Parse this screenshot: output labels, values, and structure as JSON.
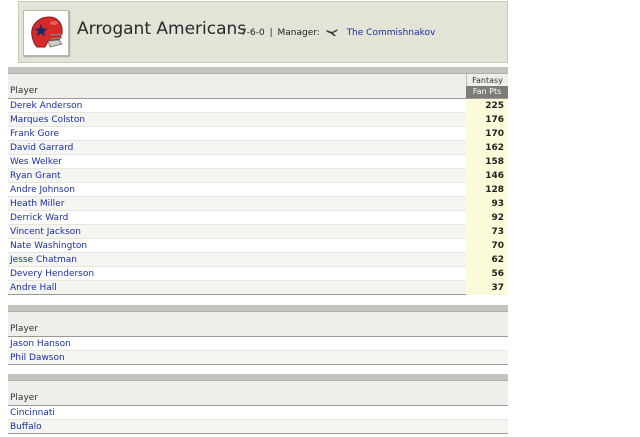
{
  "team": {
    "name": "Arrogant Americans",
    "record": "7-6-0",
    "separator": "|",
    "manager_label": "Manager:",
    "manager_name": "The Commishnakov",
    "logo_icon": "football-helmet-icon",
    "manager_icon": "airplane-icon"
  },
  "starters": {
    "header_player": "Player",
    "header_group": "Fantasy",
    "header_points": "Fan Pts",
    "rows": [
      {
        "name": "Derek Anderson",
        "pts": "225"
      },
      {
        "name": "Marques Colston",
        "pts": "176"
      },
      {
        "name": "Frank Gore",
        "pts": "170"
      },
      {
        "name": "David Garrard",
        "pts": "162"
      },
      {
        "name": "Wes Welker",
        "pts": "158"
      },
      {
        "name": "Ryan Grant",
        "pts": "146"
      },
      {
        "name": "Andre Johnson",
        "pts": "128"
      },
      {
        "name": "Heath Miller",
        "pts": "93"
      },
      {
        "name": "Derrick Ward",
        "pts": "92"
      },
      {
        "name": "Vincent Jackson",
        "pts": "73"
      },
      {
        "name": "Nate Washington",
        "pts": "70"
      },
      {
        "name": "Jesse Chatman",
        "pts": "62"
      },
      {
        "name": "Devery Henderson",
        "pts": "56"
      },
      {
        "name": "Andre Hall",
        "pts": "37"
      }
    ]
  },
  "kickers": {
    "header_player": "Player",
    "rows": [
      {
        "name": "Jason Hanson"
      },
      {
        "name": "Phil Dawson"
      }
    ]
  },
  "defenses": {
    "header_player": "Player",
    "rows": [
      {
        "name": "Cincinnati"
      },
      {
        "name": "Buffalo"
      }
    ]
  },
  "colors": {
    "link": "#1a2ea8",
    "header_bg": "#e3e3d8",
    "points_bg": "#fbfbd9",
    "fanpts_header_bg": "#7d7d76",
    "helmet_red": "#d42a2a",
    "helmet_star": "#1a2a6a"
  }
}
